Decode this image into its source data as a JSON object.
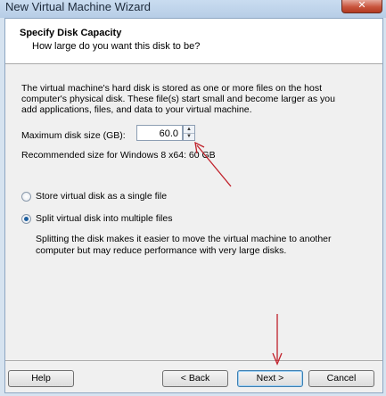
{
  "window": {
    "title": "New Virtual Machine Wizard",
    "close_glyph": "✕"
  },
  "header": {
    "title": "Specify Disk Capacity",
    "subtitle": "How large do you want this disk to be?"
  },
  "body": {
    "description_lines": [
      "The virtual machine's hard disk is stored as one or more files on the host",
      "computer's physical disk. These file(s) start small and become larger as you",
      "add applications, files, and data to your virtual machine."
    ],
    "max_size_label": "Maximum disk size (GB):",
    "max_size_value": "60.0",
    "recommended": "Recommended size for Windows 8 x64: 60 GB",
    "options": [
      {
        "label": "Store virtual disk as a single file",
        "selected": false
      },
      {
        "label": "Split virtual disk into multiple files",
        "selected": true
      }
    ],
    "split_note_lines": [
      "Splitting the disk makes it easier to move the virtual machine to another",
      "computer but may reduce performance with very large disks."
    ]
  },
  "buttons": {
    "help": "Help",
    "back": "< Back",
    "next": "Next >",
    "cancel": "Cancel"
  },
  "annotation_color": "#c0202a"
}
